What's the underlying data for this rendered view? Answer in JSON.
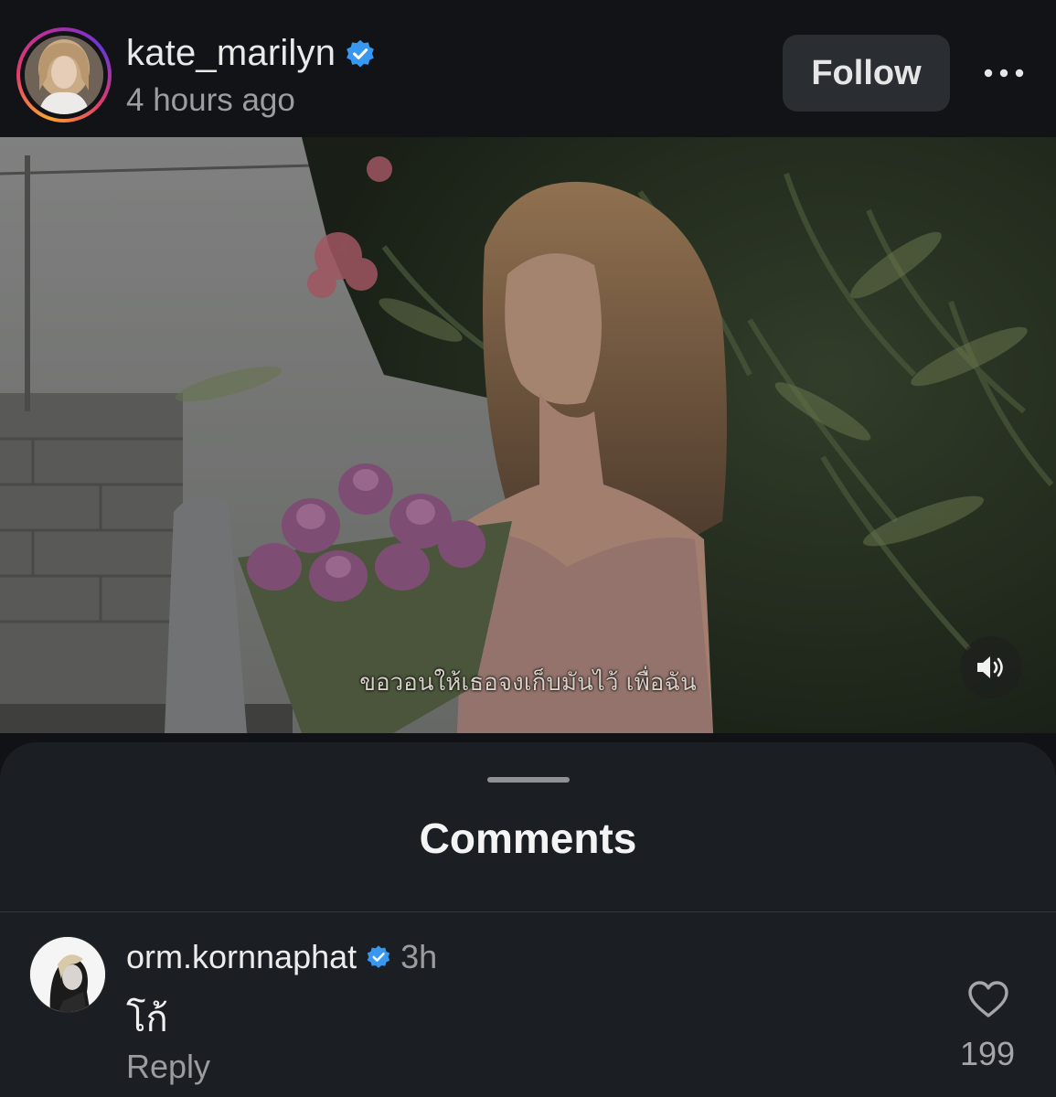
{
  "post": {
    "username": "kate_marilyn",
    "verified": true,
    "timestamp": "4 hours ago",
    "follow_label": "Follow",
    "more_icon": "more-horizontal-icon"
  },
  "video": {
    "subtitle": "ขอวอนให้เธอจงเก็บมันไว้ เพื่อฉัน",
    "sound_icon": "speaker-icon"
  },
  "comments_sheet": {
    "title": "Comments",
    "comments": [
      {
        "username": "orm.kornnaphat",
        "verified": true,
        "time": "3h",
        "text": "โก้",
        "reply_label": "Reply",
        "like_count": "199",
        "like_icon": "heart-icon"
      }
    ]
  },
  "colors": {
    "background": "#101215",
    "sheet": "#1b1e22",
    "follow_button": "#2a2d31",
    "verified_blue": "#3897f0",
    "secondary_text": "#9a9ca0"
  }
}
